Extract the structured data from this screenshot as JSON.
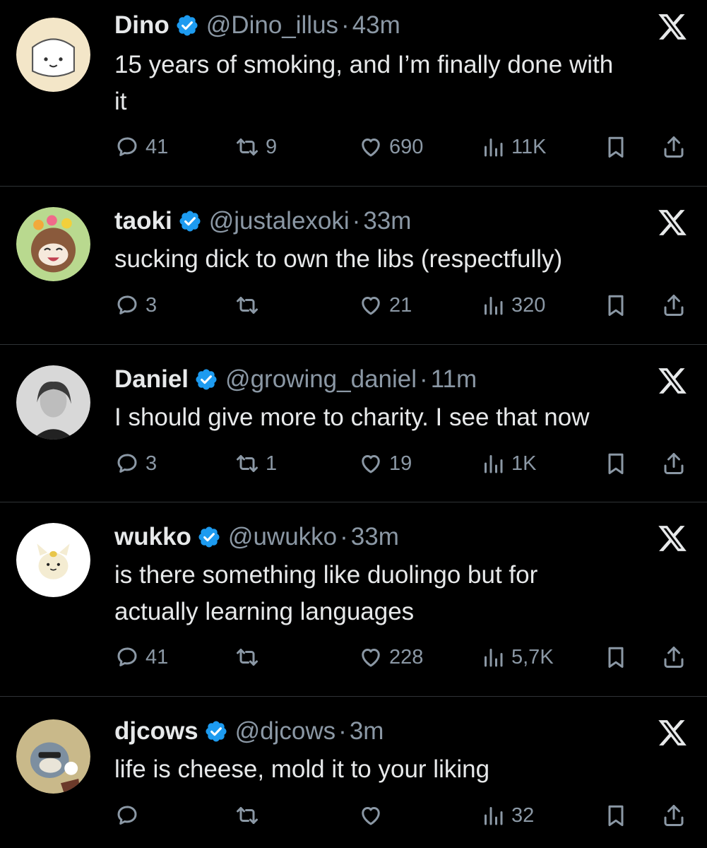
{
  "colors": {
    "background": "#000000",
    "text": "#e7e9ea",
    "secondary": "#8b98a5",
    "verified": "#1d9bf0",
    "divider": "#2f3336"
  },
  "icons": {
    "reply": "speech-bubble-icon",
    "retweet": "retweet-icon",
    "like": "heart-icon",
    "views": "bar-chart-icon",
    "bookmark": "bookmark-icon",
    "share": "share-upload-icon",
    "platform": "x-logo-icon",
    "verified": "verified-badge-icon"
  },
  "tweets": [
    {
      "name": "Dino",
      "handle": "@Dino_illus",
      "dot": "·",
      "time": "43m",
      "text_lines": [
        "15 years of smoking, and I’m finally done with",
        "it"
      ],
      "replies": "41",
      "retweets": "9",
      "likes": "690",
      "views": "11K",
      "avatar_color": "#f3e6c8"
    },
    {
      "name": "taoki",
      "handle": "@justalexoki",
      "dot": "·",
      "time": "33m",
      "text_lines": [
        "sucking dick to own the libs (respectfully)"
      ],
      "replies": "3",
      "retweets": "",
      "likes": "21",
      "views": "320",
      "avatar_color": "#b9d98f"
    },
    {
      "name": "Daniel",
      "handle": "@growing_daniel",
      "dot": "·",
      "time": "11m",
      "text_lines": [
        "I should give more to charity. I see that now"
      ],
      "replies": "3",
      "retweets": "1",
      "likes": "19",
      "views": "1K",
      "avatar_color": "#9a9a9a"
    },
    {
      "name": "wukko",
      "handle": "@uwukko",
      "dot": "·",
      "time": "33m",
      "text_lines": [
        "is there something like duolingo but for",
        "actually learning languages"
      ],
      "replies": "41",
      "retweets": "",
      "likes": "228",
      "views": "5,7K",
      "avatar_color": "#ffffff"
    },
    {
      "name": "djcows",
      "handle": "@djcows",
      "dot": "·",
      "time": "3m",
      "text_lines": [
        "life is cheese, mold it to your liking"
      ],
      "replies": "",
      "retweets": "",
      "likes": "",
      "views": "32",
      "avatar_color": "#c9b98a"
    }
  ]
}
